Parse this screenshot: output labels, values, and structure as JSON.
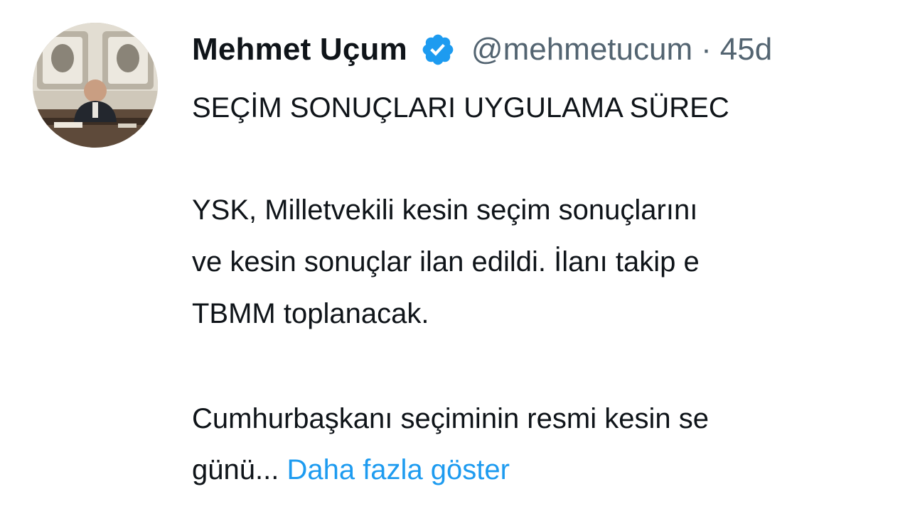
{
  "author": {
    "display_name": "Mehmet Uçum",
    "handle": "@mehmetucum",
    "separator": "·",
    "time": "45d",
    "verified": true
  },
  "tweet": {
    "lines": [
      "SEÇİM SONUÇLARI UYGULAMA SÜREC",
      "YSK, Milletvekili kesin seçim sonuçlarını",
      "ve kesin sonuçlar ilan edildi. İlanı takip e",
      "TBMM toplanacak.",
      "Cumhurbaşkanı seçiminin resmi kesin se",
      "günü..."
    ],
    "show_more": "Daha fazla göster"
  },
  "colors": {
    "text": "#0f1419",
    "secondary": "#536471",
    "link": "#1d9bf0",
    "verified_badge": "#1d9bf0"
  },
  "icons": {
    "verified": "verified-badge-icon",
    "avatar": "profile-photo"
  }
}
